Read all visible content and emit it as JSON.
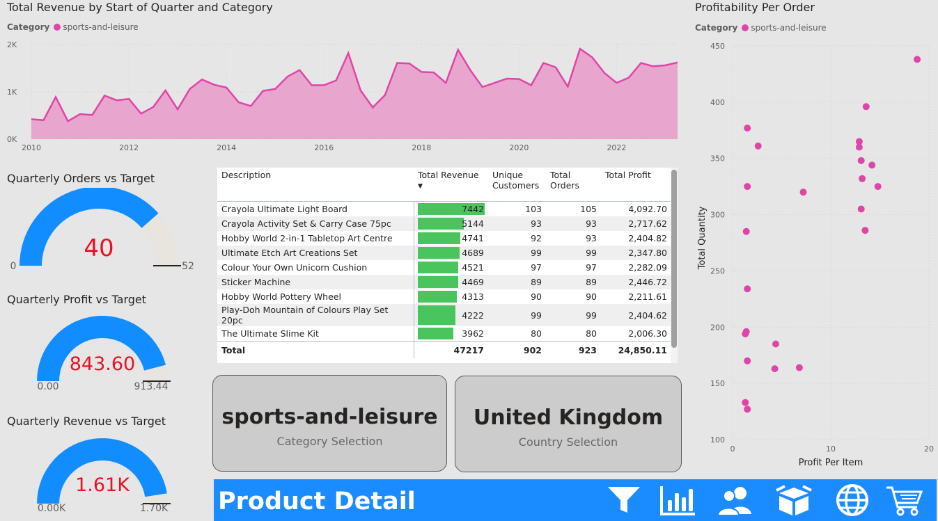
{
  "area_chart": {
    "title": "Total Revenue by Start of Quarter and Category",
    "legend_title": "Category",
    "legend_item": "sports-and-leisure",
    "series_color": "#e044a8",
    "fill_color": "#e8a6cf",
    "y_ticks": [
      "2K",
      "1K",
      "0K"
    ],
    "x_ticks": [
      "2010",
      "2012",
      "2014",
      "2016",
      "2018",
      "2020",
      "2022"
    ]
  },
  "chart_data": [
    {
      "type": "area",
      "title": "Total Revenue by Start of Quarter and Category",
      "series": [
        {
          "name": "sports-and-leisure",
          "values": [
            420,
            400,
            890,
            380,
            530,
            510,
            920,
            820,
            850,
            540,
            680,
            1030,
            630,
            1060,
            1260,
            1150,
            1090,
            780,
            700,
            1020,
            1060,
            1320,
            1460,
            1140,
            1140,
            1240,
            1820,
            1030,
            670,
            930,
            1610,
            1600,
            1420,
            1410,
            1190,
            1890,
            1460,
            1100,
            1190,
            1280,
            1270,
            1140,
            1610,
            1520,
            1110,
            1910,
            1730,
            1400,
            1190,
            1300,
            1610,
            1540,
            1560,
            1620
          ]
        }
      ],
      "x_start": 2010,
      "x_step": "quarter",
      "ylim": [
        0,
        2000
      ],
      "x_ticks": [
        "2010",
        "2012",
        "2014",
        "2016",
        "2018",
        "2020",
        "2022"
      ]
    },
    {
      "type": "scatter",
      "title": "Profitability Per Order",
      "xlabel": "Profit Per Item",
      "ylabel": "Total Quantity",
      "xlim": [
        0,
        20
      ],
      "ylim": [
        100,
        450
      ],
      "x_ticks": [
        0,
        10,
        20
      ],
      "y_ticks": [
        100,
        150,
        200,
        250,
        300,
        350,
        400,
        450
      ],
      "series": [
        {
          "name": "sports-and-leisure",
          "points": [
            [
              18.8,
              438
            ],
            [
              13.6,
              396
            ],
            [
              1.5,
              377
            ],
            [
              2.6,
              361
            ],
            [
              12.9,
              365
            ],
            [
              12.9,
              360
            ],
            [
              13.1,
              348
            ],
            [
              14.2,
              344
            ],
            [
              13.2,
              332
            ],
            [
              14.8,
              325
            ],
            [
              1.5,
              325
            ],
            [
              7.2,
              320
            ],
            [
              13.1,
              305
            ],
            [
              13.5,
              286
            ],
            [
              1.4,
              285
            ],
            [
              1.5,
              234
            ],
            [
              1.4,
              196
            ],
            [
              1.3,
              194
            ],
            [
              4.4,
              185
            ],
            [
              1.5,
              170
            ],
            [
              6.8,
              164
            ],
            [
              4.3,
              163
            ],
            [
              1.3,
              133
            ],
            [
              1.5,
              127
            ]
          ]
        }
      ]
    }
  ],
  "scatter": {
    "title": "Profitability Per Order",
    "legend_title": "Category",
    "legend_item": "sports-and-leisure",
    "xlabel": "Profit Per Item",
    "ylabel": "Total Quantity"
  },
  "gauges": [
    {
      "title": "Quarterly Orders vs Target",
      "value": "40",
      "min": "0",
      "max": "52",
      "fraction": 0.77,
      "target_fraction": 1.0
    },
    {
      "title": "Quarterly Profit vs Target",
      "value": "843.60",
      "min": "0.00",
      "max": "913.44",
      "fraction": 0.92,
      "target_fraction": 1.0
    },
    {
      "title": "Quarterly Revenue vs Target",
      "value": "1.61K",
      "min": "0.00K",
      "max": "1.70K",
      "fraction": 0.95,
      "target_fraction": 1.0
    }
  ],
  "table": {
    "headers": [
      "Description",
      "Total Revenue",
      "Unique Customers",
      "Total Orders",
      "Total Profit"
    ],
    "max_revenue": 7442,
    "rows": [
      {
        "description": "Crayola Ultimate Light Board",
        "revenue": "7442",
        "rev_num": 7442,
        "customers": "103",
        "orders": "105",
        "profit": "4,092.70"
      },
      {
        "description": "Crayola Activity Set & Carry Case 75pc",
        "revenue": "5144",
        "rev_num": 5144,
        "customers": "93",
        "orders": "93",
        "profit": "2,717.62"
      },
      {
        "description": "Hobby World 2-in-1 Tabletop Art Centre",
        "revenue": "4741",
        "rev_num": 4741,
        "customers": "92",
        "orders": "93",
        "profit": "2,404.82"
      },
      {
        "description": "Ultimate Etch Art Creations Set",
        "revenue": "4689",
        "rev_num": 4689,
        "customers": "99",
        "orders": "99",
        "profit": "2,347.80"
      },
      {
        "description": "Colour Your Own Unicorn Cushion",
        "revenue": "4521",
        "rev_num": 4521,
        "customers": "97",
        "orders": "97",
        "profit": "2,282.09"
      },
      {
        "description": "Sticker Machine",
        "revenue": "4469",
        "rev_num": 4469,
        "customers": "89",
        "orders": "89",
        "profit": "2,446.72"
      },
      {
        "description": "Hobby World Pottery Wheel",
        "revenue": "4313",
        "rev_num": 4313,
        "customers": "90",
        "orders": "90",
        "profit": "2,211.61"
      },
      {
        "description": "Play-Doh Mountain of Colours Play Set 20pc",
        "revenue": "4222",
        "rev_num": 4222,
        "customers": "99",
        "orders": "99",
        "profit": "2,404.62"
      },
      {
        "description": "The Ultimate Slime Kit",
        "revenue": "3962",
        "rev_num": 3962,
        "customers": "80",
        "orders": "80",
        "profit": "2,006.30"
      }
    ],
    "total": {
      "label": "Total",
      "revenue": "47217",
      "customers": "902",
      "orders": "923",
      "profit": "24,850.11"
    }
  },
  "cards": [
    {
      "value": "sports-and-leisure",
      "label": "Category Selection"
    },
    {
      "value": "United Kingdom",
      "label": "Country Selection"
    }
  ],
  "banner": {
    "title": "Product Detail",
    "nav_icons": [
      "filter-icon",
      "bar-chart-icon",
      "customers-icon",
      "box-icon",
      "globe-icon",
      "cart-icon"
    ],
    "color": "#1a8cff"
  }
}
